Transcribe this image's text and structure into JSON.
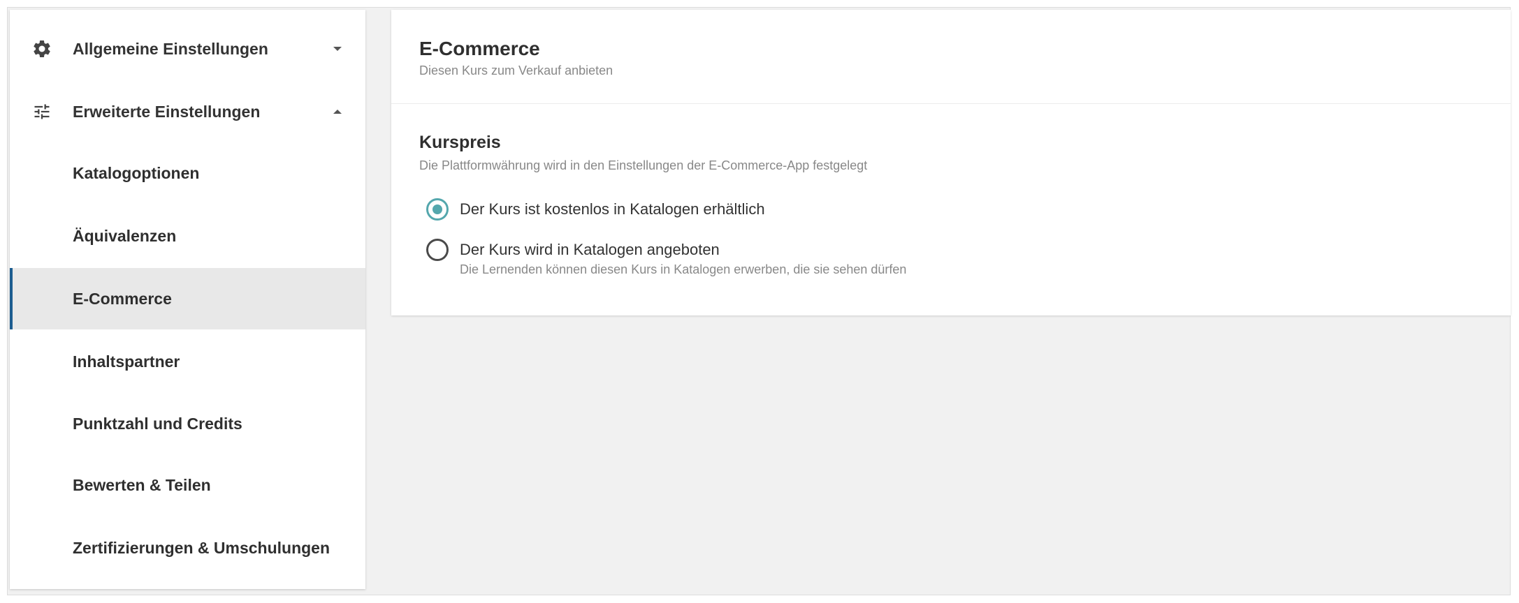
{
  "sidebar": {
    "items": [
      {
        "label": "Allgemeine Einstellungen",
        "icon": "gear-icon",
        "expanded": false
      },
      {
        "label": "Erweiterte Einstellungen",
        "icon": "sliders-icon",
        "expanded": true
      },
      {
        "label": "Katalogoptionen"
      },
      {
        "label": "Äquivalenzen"
      },
      {
        "label": "E-Commerce",
        "active": true
      },
      {
        "label": "Inhaltspartner"
      },
      {
        "label": "Punktzahl und Credits"
      },
      {
        "label": "Bewerten & Teilen"
      },
      {
        "label": "Zertifizierungen & Umschulungen"
      }
    ]
  },
  "main": {
    "title": "E-Commerce",
    "subtitle": "Diesen Kurs zum Verkauf anbieten",
    "section": {
      "title": "Kurspreis",
      "subtitle": "Die Plattformwährung wird in den Einstellungen der E-Commerce-App festgelegt",
      "options": [
        {
          "label": "Der Kurs ist kostenlos in Katalogen erhältlich",
          "checked": true
        },
        {
          "label": "Der Kurs wird in Katalogen angeboten",
          "help": "Die Lernenden können diesen Kurs in Katalogen erwerben, die sie sehen dürfen",
          "checked": false
        }
      ]
    }
  },
  "colors": {
    "accent": "#54a7ad",
    "active_border": "#1d5d90",
    "active_bg": "#e8e8e8",
    "page_bg": "#f1f1f1"
  }
}
